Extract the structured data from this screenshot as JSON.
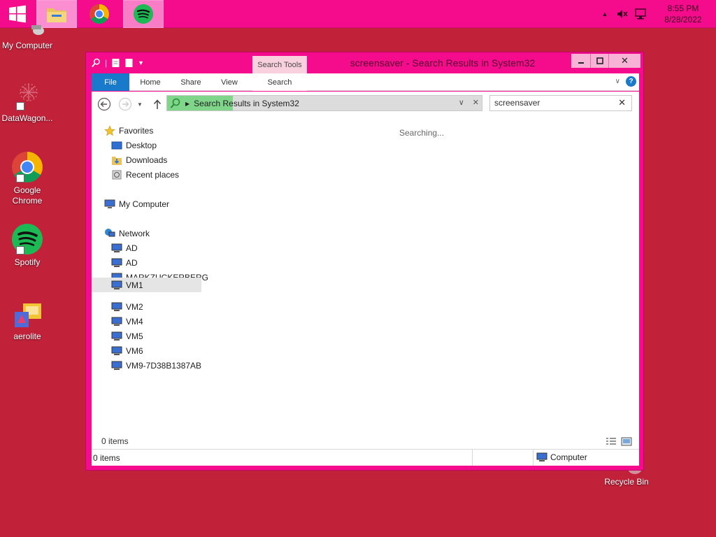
{
  "taskbar": {
    "start_icon": "windows-logo-icon",
    "apps": [
      {
        "name": "file-explorer",
        "icon": "folder-icon",
        "active": true
      },
      {
        "name": "google-chrome",
        "icon": "chrome-icon",
        "active": false
      },
      {
        "name": "spotify",
        "icon": "spotify-icon",
        "active": true
      }
    ],
    "tray": {
      "overflow_icon": "chevron-up-icon",
      "volume_icon": "volume-muted-icon",
      "network_icon": "network-icon",
      "time": "8:55 PM",
      "date": "8/28/2022"
    },
    "accent": "#f50c8c"
  },
  "desktop": {
    "background": "#c1223a",
    "icons": [
      {
        "label": "My Computer",
        "icon": "computer-icon"
      },
      {
        "label": "DataWagon...",
        "icon": "datawagon-icon"
      },
      {
        "label": "Google Chrome",
        "icon": "chrome-icon"
      },
      {
        "label": "Spotify",
        "icon": "spotify-icon"
      },
      {
        "label": "aerolite",
        "icon": "aerolite-icon"
      },
      {
        "label": "Recycle Bin",
        "icon": "recycle-bin-icon"
      }
    ]
  },
  "window": {
    "title": "screensaver - Search Results in System32",
    "context_tab": "Search Tools",
    "ribbon_tabs": [
      "File",
      "Home",
      "Share",
      "View",
      "Search"
    ],
    "address": {
      "location": "Search Results in System32",
      "progress_color": "#7fd68b"
    },
    "search": {
      "value": "screensaver",
      "placeholder": ""
    },
    "nav": {
      "favorites": {
        "label": "Favorites",
        "items": [
          "Desktop",
          "Downloads",
          "Recent places"
        ]
      },
      "computer": "My Computer",
      "network": {
        "label": "Network",
        "items": [
          "AD",
          "AD",
          "MARKZUCKERBERG",
          "VM1",
          "VM2",
          "VM4",
          "VM5",
          "VM6",
          "VM9-7D38B1387AB"
        ],
        "selected": "VM1"
      }
    },
    "searching_text": "Searching...",
    "status_items": "0 items",
    "statusbar": {
      "left": "0 items",
      "right": "Computer"
    }
  }
}
